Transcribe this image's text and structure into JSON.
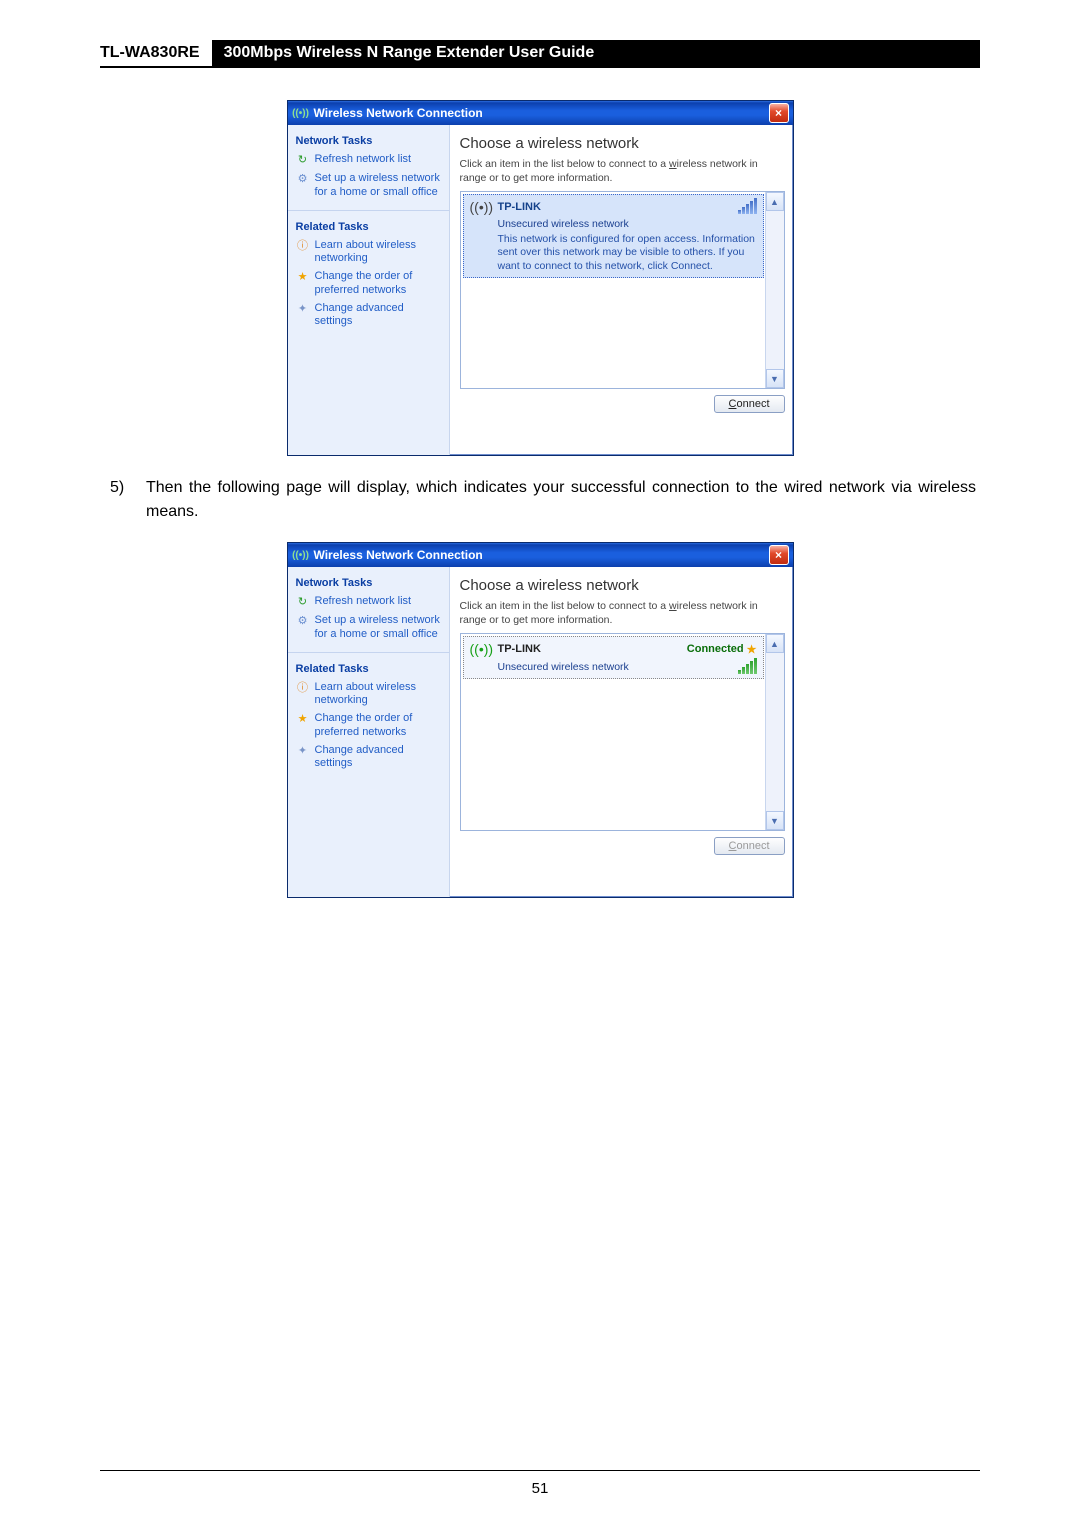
{
  "header": {
    "model": "TL-WA830RE",
    "title": "300Mbps Wireless N Range Extender User Guide"
  },
  "window": {
    "title": "Wireless Network Connection",
    "sidebar": {
      "tasks_title": "Network Tasks",
      "refresh": "Refresh network list",
      "setup": "Set up a wireless network for a home or small office",
      "related_title": "Related Tasks",
      "learn": "Learn about wireless networking",
      "order": "Change the order of preferred networks",
      "advanced": "Change advanced settings"
    },
    "main": {
      "heading": "Choose a wireless network",
      "sub_before": "Click an item in the list below to connect to a ",
      "sub_underlined": "w",
      "sub_after_u": "ireless network in range or to get more information.",
      "net_name": "TP-LINK",
      "security": "Unsecured wireless network",
      "open_info": "This network is configured for open access. Information sent over this network may be visible to others. If you want to connect to this network, click Connect.",
      "connected": "Connected",
      "connect_btn_u": "C",
      "connect_btn_rest": "onnect"
    }
  },
  "step": {
    "num": "5)",
    "text": "Then the following page will display, which indicates your successful connection to the wired network via wireless means."
  },
  "page_number": "51"
}
